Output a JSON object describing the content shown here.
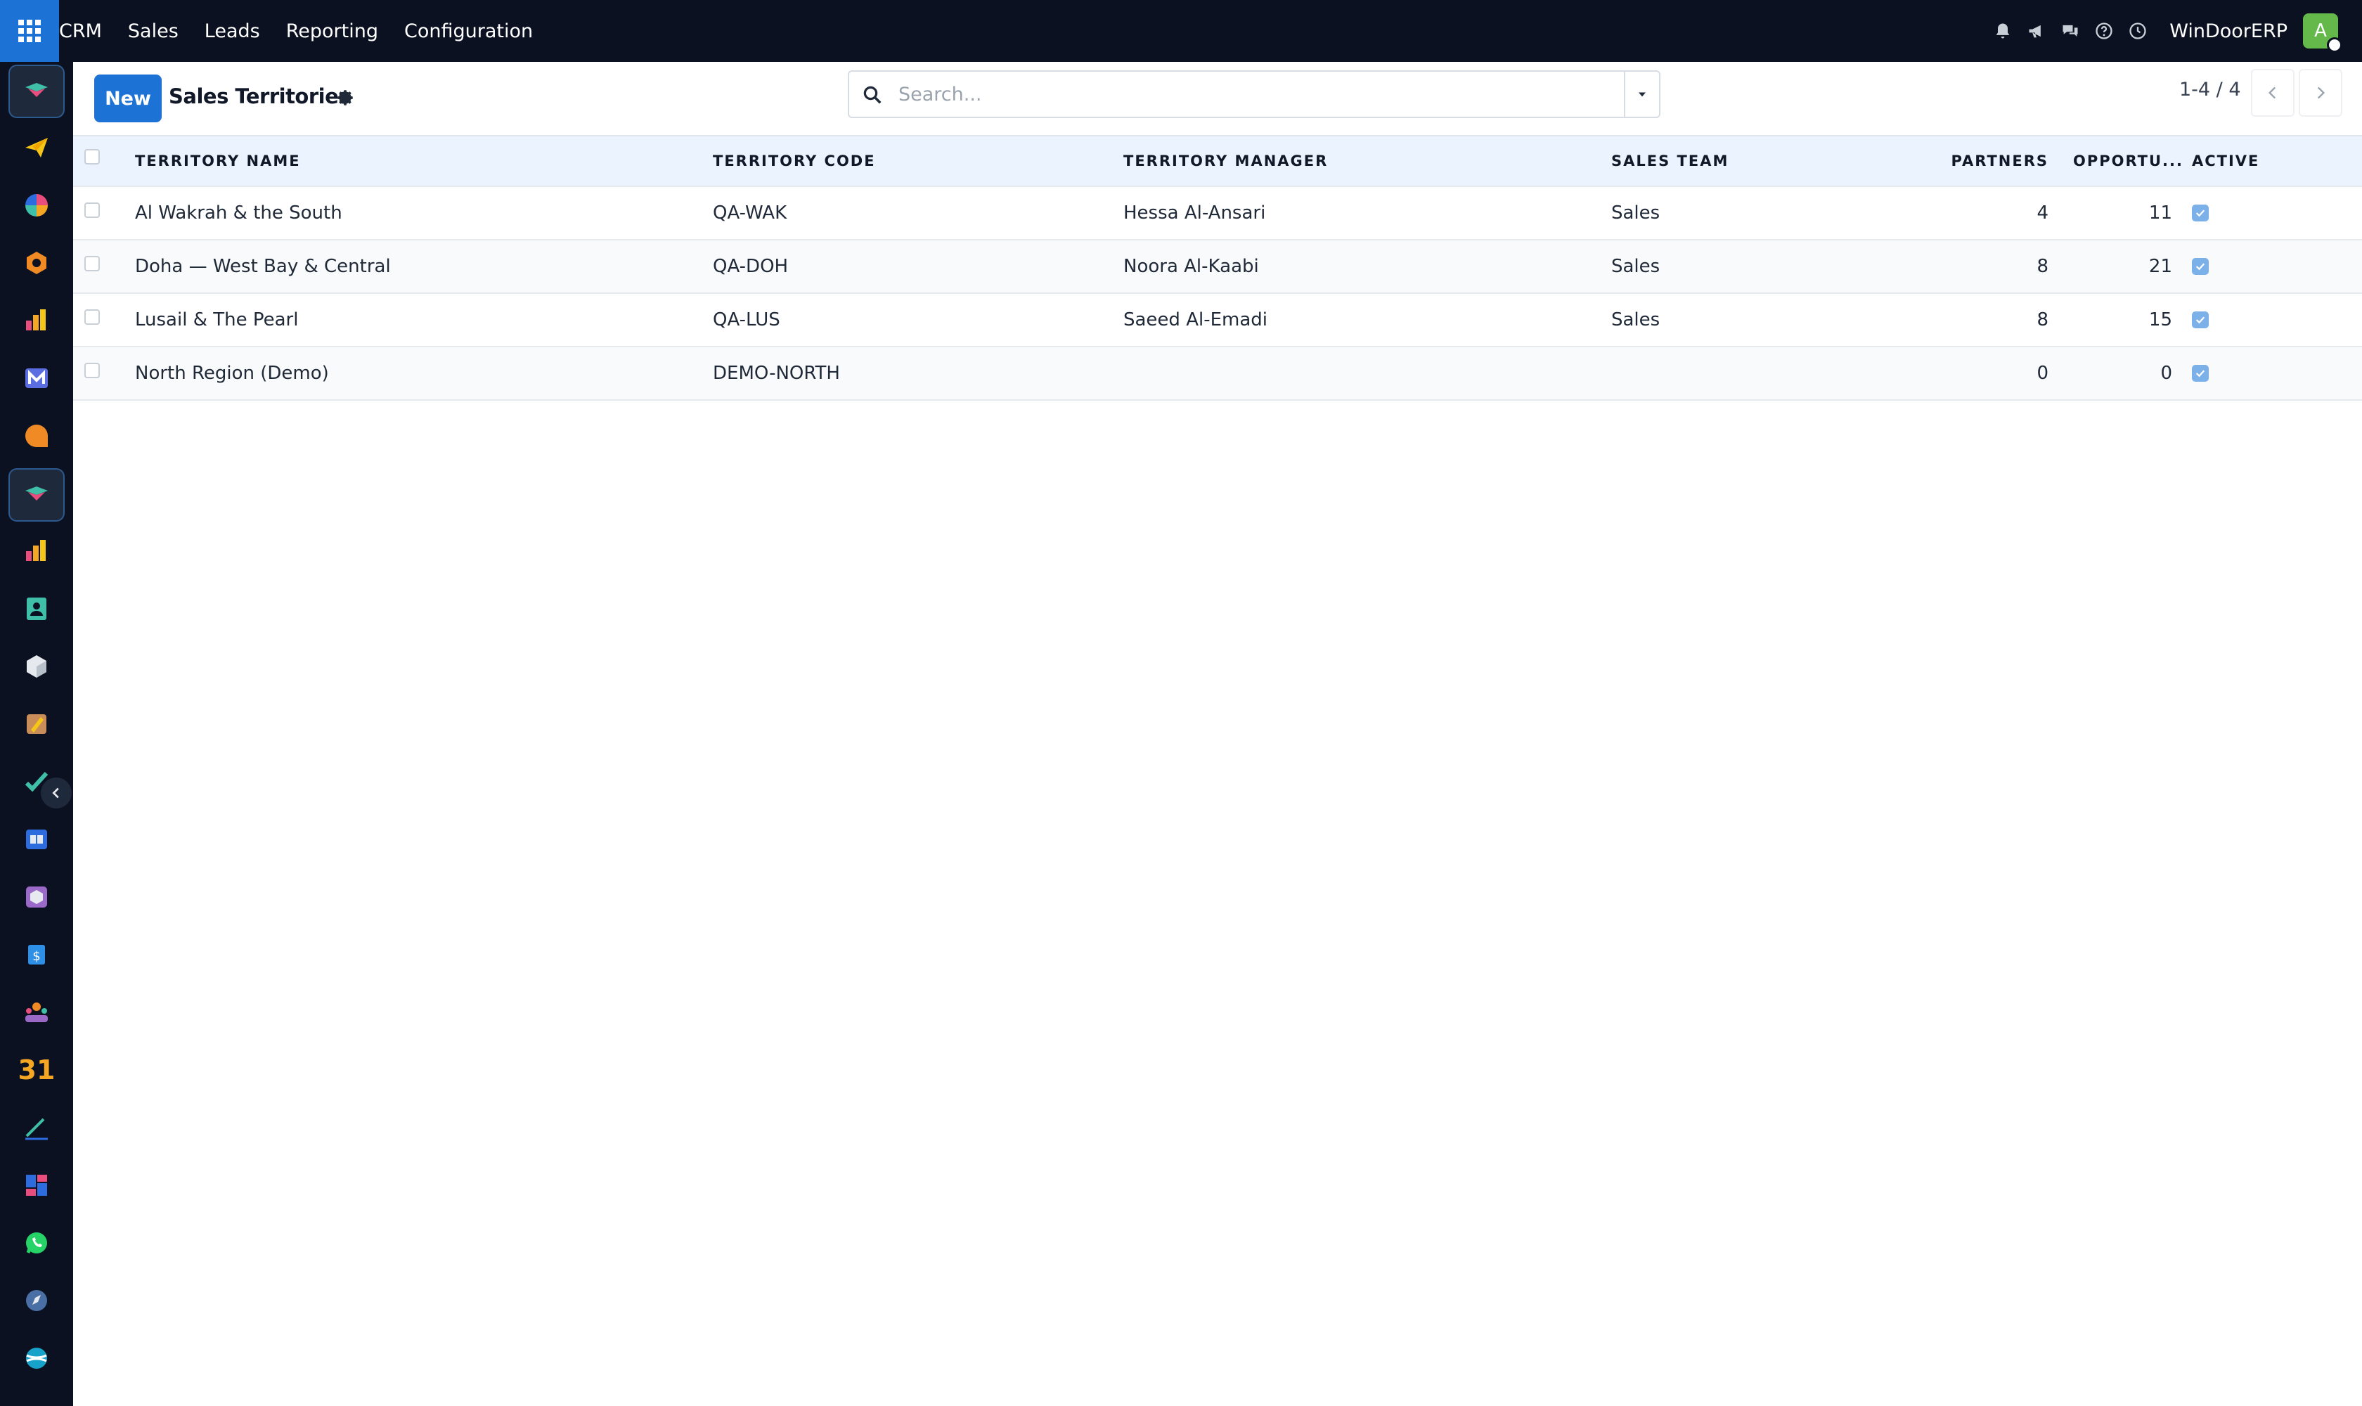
{
  "topbar": {
    "menu": [
      "CRM",
      "Sales",
      "Leads",
      "Reporting",
      "Configuration"
    ],
    "company": "WinDoorERP",
    "avatar_letter": "A",
    "icons": [
      "bell-icon",
      "megaphone-icon",
      "chat-icon",
      "help-icon",
      "clock-icon"
    ]
  },
  "sidebar": {
    "apps": [
      "crm-icon",
      "send-icon",
      "pie-chart-icon",
      "hex-icon",
      "bar-chart-icon",
      "mail-icon",
      "chat-bubble-icon",
      "crm-icon",
      "bar-chart-icon",
      "contacts-icon",
      "box-icon",
      "paint-icon",
      "check-icon",
      "knowledge-icon",
      "inventory-icon",
      "accounting-icon",
      "team-icon",
      "calendar-icon",
      "sign-icon",
      "dashboard-icon",
      "whatsapp-icon",
      "compass-icon",
      "sphere-icon"
    ],
    "calendar_label": "31"
  },
  "controlbar": {
    "new_label": "New",
    "title": "Sales Territories",
    "search_placeholder": "Search...",
    "pager": "1-4 / 4"
  },
  "table": {
    "columns": {
      "name": "TERRITORY NAME",
      "code": "TERRITORY CODE",
      "manager": "TERRITORY MANAGER",
      "team": "SALES TEAM",
      "partners": "PARTNERS",
      "opportunities": "OPPORTU...",
      "active": "ACTIVE"
    },
    "rows": [
      {
        "name": "Al Wakrah & the South",
        "code": "QA-WAK",
        "manager": "Hessa Al-Ansari",
        "team": "Sales",
        "partners": "4",
        "opportunities": "11",
        "active": true
      },
      {
        "name": "Doha — West Bay & Central",
        "code": "QA-DOH",
        "manager": "Noora Al-Kaabi",
        "team": "Sales",
        "partners": "8",
        "opportunities": "21",
        "active": true
      },
      {
        "name": "Lusail & The Pearl",
        "code": "QA-LUS",
        "manager": "Saeed Al-Emadi",
        "team": "Sales",
        "partners": "8",
        "opportunities": "15",
        "active": true
      },
      {
        "name": "North Region (Demo)",
        "code": "DEMO-NORTH",
        "manager": "",
        "team": "",
        "partners": "0",
        "opportunities": "0",
        "active": true
      }
    ]
  }
}
